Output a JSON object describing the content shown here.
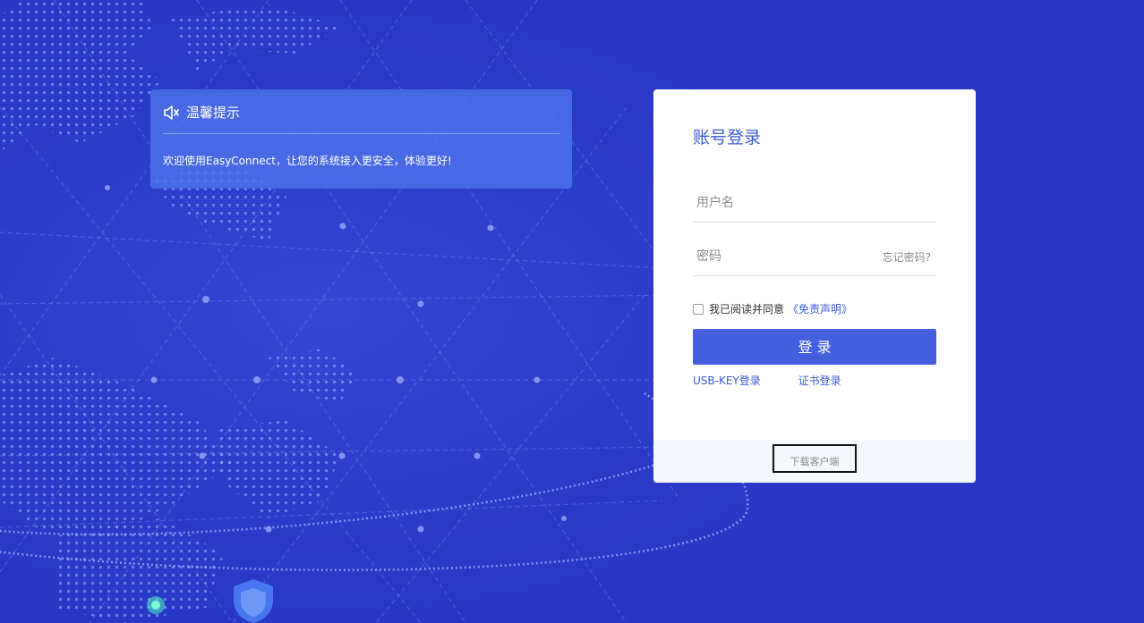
{
  "notice": {
    "icon": "speaker-icon",
    "title": "温馨提示",
    "message": "欢迎使用EasyConnect，让您的系统接入更安全，体验更好!"
  },
  "login": {
    "title": "账号登录",
    "username_placeholder": "用户名",
    "password_placeholder": "密码",
    "forgot_label": "忘记密码?",
    "agree_text": "我已阅读并同意",
    "disclaimer_link": "《免责声明》",
    "submit_label": "登 录",
    "usb_key_label": "USB-KEY登录",
    "cert_label": "证书登录",
    "download_label": "下载客户端"
  },
  "colors": {
    "background": "#2838c4",
    "accent": "#4560de",
    "link": "#3b5bd6"
  }
}
